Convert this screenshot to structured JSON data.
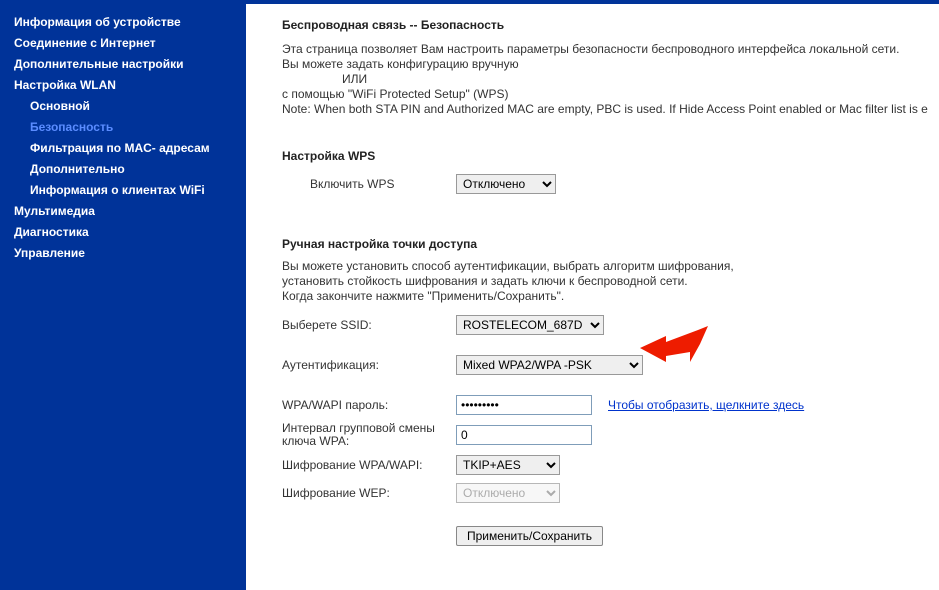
{
  "sidebar": {
    "items": [
      {
        "label": "Информация об устройстве",
        "type": "item"
      },
      {
        "label": "Соединение с Интернет",
        "type": "item"
      },
      {
        "label": "Дополнительные настройки",
        "type": "item"
      },
      {
        "label": "Настройка WLAN",
        "type": "item"
      },
      {
        "label": "Основной",
        "type": "sub"
      },
      {
        "label": "Безопасность",
        "type": "sub",
        "active": true
      },
      {
        "label": "Фильтрация по MAC- адресам",
        "type": "sub"
      },
      {
        "label": "Дополнительно",
        "type": "sub"
      },
      {
        "label": "Информация о клиентах WiFi",
        "type": "sub"
      },
      {
        "label": "Мультимедиа",
        "type": "item"
      },
      {
        "label": "Диагностика",
        "type": "item"
      },
      {
        "label": "Управление",
        "type": "item"
      }
    ]
  },
  "page": {
    "title": "Беспроводная связь -- Безопасность",
    "desc_line1": "Эта страница позволяет Вам настроить параметры безопасности беспроводного интерфейса локальной сети.",
    "desc_line2": "Вы можете задать конфигурацию вручную",
    "desc_or": "ИЛИ",
    "desc_line3": "с помощью \"WiFi Protected Setup\" (WPS)",
    "desc_note": "Note: When both STA PIN and Authorized MAC are empty, PBC is used. If Hide Access Point enabled or Mac filter list is e"
  },
  "wps": {
    "title": "Настройка WPS",
    "enable_label": "Включить WPS",
    "value": "Отключено"
  },
  "manual": {
    "title": "Ручная настройка точки доступа",
    "text_line1": "Вы можете установить способ аутентификации, выбрать алгоритм шифрования,",
    "text_line2": "установить стойкость шифрования и задать ключи к беспроводной сети.",
    "text_line3": "Когда закончите нажмите \"Применить/Сохранить\".",
    "ssid_label": "Выберете SSID:",
    "ssid_value": "ROSTELECOM_687D",
    "auth_label": "Аутентификация:",
    "auth_value": "Mixed WPA2/WPA -PSK",
    "password_label": "WPA/WAPI пароль:",
    "password_value": "•••••••••",
    "show_link": "Чтобы отобразить, щелкните здесь",
    "interval_label": "Интервал групповой смены ключа WPA:",
    "interval_value": "0",
    "enc_wpa_label": "Шифрование WPA/WAPI:",
    "enc_wpa_value": "TKIP+AES",
    "enc_wep_label": "Шифрование WEP:",
    "enc_wep_value": "Отключено"
  },
  "submit_label": "Применить/Сохранить"
}
